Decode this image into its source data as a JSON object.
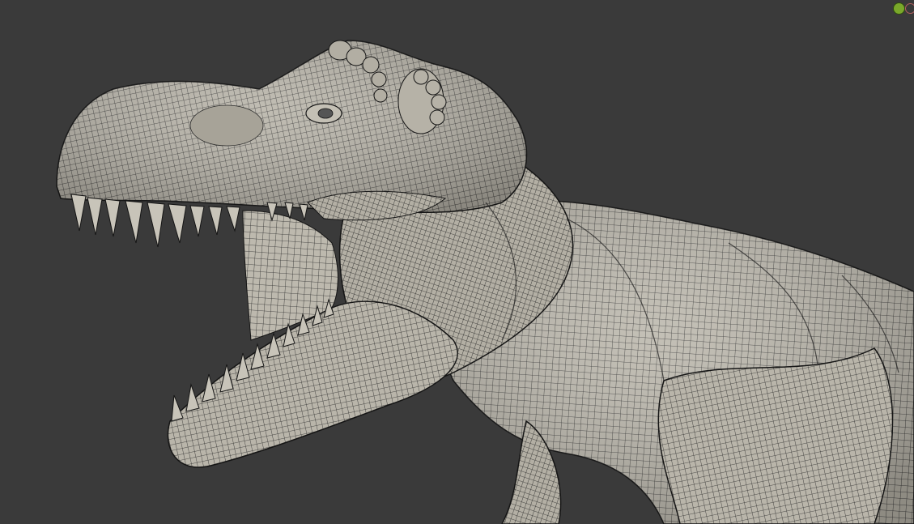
{
  "viewport": {
    "background_color": "#3a3a3a",
    "shading_mode": "wireframe-on-shaded",
    "subject": "t-rex-sculpt",
    "mesh_color": "#b7b3a8",
    "wire_color": "#1e1e1e"
  },
  "indicators": {
    "status_dot_color": "#7aa82a",
    "secondary_dot_color": "#b06060"
  }
}
